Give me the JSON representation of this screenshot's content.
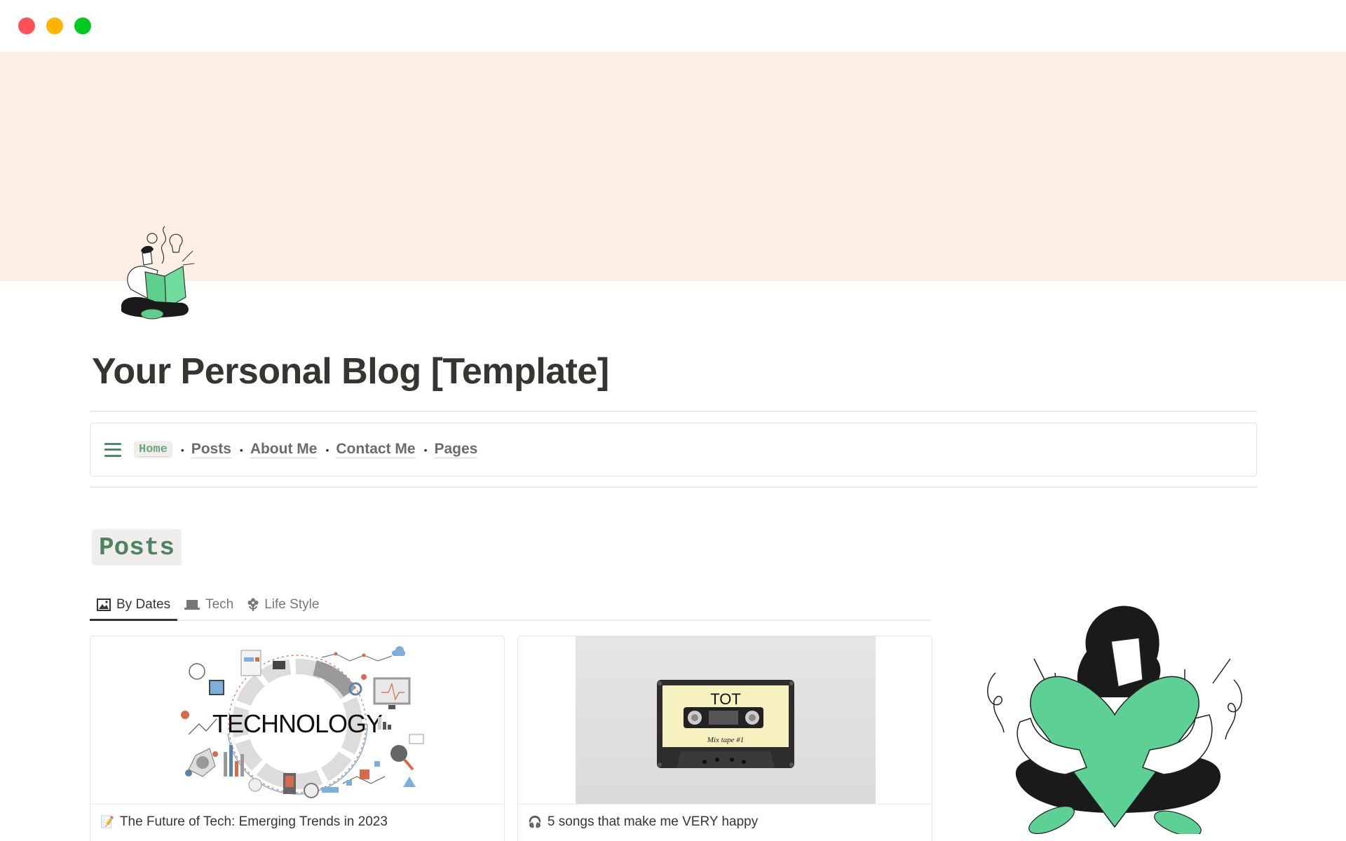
{
  "window": {
    "controls": [
      "close",
      "minimize",
      "maximize"
    ]
  },
  "cover": {
    "color": "#fcefe3"
  },
  "page": {
    "title": "Your Personal Blog [Template]",
    "icon": "reading-person-illustration"
  },
  "nav": {
    "menu_icon": "hamburger-menu-icon",
    "home_label": "Home",
    "links": [
      "Posts",
      "About Me",
      "Contact Me",
      "Pages"
    ],
    "separator": "•",
    "accent": "#4f8a66"
  },
  "posts": {
    "heading": "Posts",
    "tabs": [
      {
        "label": "By Dates",
        "icon": "image-icon",
        "active": true
      },
      {
        "label": "Tech",
        "icon": "laptop-icon",
        "active": false
      },
      {
        "label": "Life Style",
        "icon": "flower-icon",
        "active": false
      }
    ],
    "cards": [
      {
        "title": "The Future of Tech: Emerging Trends in 2023",
        "emoji": "📝",
        "image": "technology-collage",
        "image_text": "TECHNOLOGY"
      },
      {
        "title": "5 songs that make me VERY happy",
        "emoji": "🎧",
        "image": "cassette-tape",
        "image_text": "TOT",
        "image_subtext": "Mix tape #1"
      }
    ]
  },
  "side_illustration": "person-hugging-heart"
}
